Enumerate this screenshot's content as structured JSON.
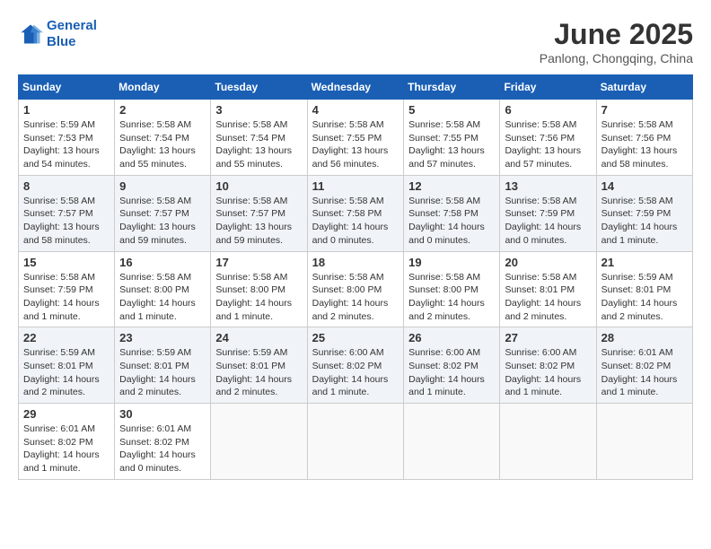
{
  "header": {
    "logo_line1": "General",
    "logo_line2": "Blue",
    "month_year": "June 2025",
    "location": "Panlong, Chongqing, China"
  },
  "weekdays": [
    "Sunday",
    "Monday",
    "Tuesday",
    "Wednesday",
    "Thursday",
    "Friday",
    "Saturday"
  ],
  "weeks": [
    [
      {
        "day": 1,
        "sunrise": "5:59 AM",
        "sunset": "7:53 PM",
        "daylight": "13 hours and 54 minutes."
      },
      {
        "day": 2,
        "sunrise": "5:58 AM",
        "sunset": "7:54 PM",
        "daylight": "13 hours and 55 minutes."
      },
      {
        "day": 3,
        "sunrise": "5:58 AM",
        "sunset": "7:54 PM",
        "daylight": "13 hours and 55 minutes."
      },
      {
        "day": 4,
        "sunrise": "5:58 AM",
        "sunset": "7:55 PM",
        "daylight": "13 hours and 56 minutes."
      },
      {
        "day": 5,
        "sunrise": "5:58 AM",
        "sunset": "7:55 PM",
        "daylight": "13 hours and 57 minutes."
      },
      {
        "day": 6,
        "sunrise": "5:58 AM",
        "sunset": "7:56 PM",
        "daylight": "13 hours and 57 minutes."
      },
      {
        "day": 7,
        "sunrise": "5:58 AM",
        "sunset": "7:56 PM",
        "daylight": "13 hours and 58 minutes."
      }
    ],
    [
      {
        "day": 8,
        "sunrise": "5:58 AM",
        "sunset": "7:57 PM",
        "daylight": "13 hours and 58 minutes."
      },
      {
        "day": 9,
        "sunrise": "5:58 AM",
        "sunset": "7:57 PM",
        "daylight": "13 hours and 59 minutes."
      },
      {
        "day": 10,
        "sunrise": "5:58 AM",
        "sunset": "7:57 PM",
        "daylight": "13 hours and 59 minutes."
      },
      {
        "day": 11,
        "sunrise": "5:58 AM",
        "sunset": "7:58 PM",
        "daylight": "14 hours and 0 minutes."
      },
      {
        "day": 12,
        "sunrise": "5:58 AM",
        "sunset": "7:58 PM",
        "daylight": "14 hours and 0 minutes."
      },
      {
        "day": 13,
        "sunrise": "5:58 AM",
        "sunset": "7:59 PM",
        "daylight": "14 hours and 0 minutes."
      },
      {
        "day": 14,
        "sunrise": "5:58 AM",
        "sunset": "7:59 PM",
        "daylight": "14 hours and 1 minute."
      }
    ],
    [
      {
        "day": 15,
        "sunrise": "5:58 AM",
        "sunset": "7:59 PM",
        "daylight": "14 hours and 1 minute."
      },
      {
        "day": 16,
        "sunrise": "5:58 AM",
        "sunset": "8:00 PM",
        "daylight": "14 hours and 1 minute."
      },
      {
        "day": 17,
        "sunrise": "5:58 AM",
        "sunset": "8:00 PM",
        "daylight": "14 hours and 1 minute."
      },
      {
        "day": 18,
        "sunrise": "5:58 AM",
        "sunset": "8:00 PM",
        "daylight": "14 hours and 2 minutes."
      },
      {
        "day": 19,
        "sunrise": "5:58 AM",
        "sunset": "8:00 PM",
        "daylight": "14 hours and 2 minutes."
      },
      {
        "day": 20,
        "sunrise": "5:58 AM",
        "sunset": "8:01 PM",
        "daylight": "14 hours and 2 minutes."
      },
      {
        "day": 21,
        "sunrise": "5:59 AM",
        "sunset": "8:01 PM",
        "daylight": "14 hours and 2 minutes."
      }
    ],
    [
      {
        "day": 22,
        "sunrise": "5:59 AM",
        "sunset": "8:01 PM",
        "daylight": "14 hours and 2 minutes."
      },
      {
        "day": 23,
        "sunrise": "5:59 AM",
        "sunset": "8:01 PM",
        "daylight": "14 hours and 2 minutes."
      },
      {
        "day": 24,
        "sunrise": "5:59 AM",
        "sunset": "8:01 PM",
        "daylight": "14 hours and 2 minutes."
      },
      {
        "day": 25,
        "sunrise": "6:00 AM",
        "sunset": "8:02 PM",
        "daylight": "14 hours and 1 minute."
      },
      {
        "day": 26,
        "sunrise": "6:00 AM",
        "sunset": "8:02 PM",
        "daylight": "14 hours and 1 minute."
      },
      {
        "day": 27,
        "sunrise": "6:00 AM",
        "sunset": "8:02 PM",
        "daylight": "14 hours and 1 minute."
      },
      {
        "day": 28,
        "sunrise": "6:01 AM",
        "sunset": "8:02 PM",
        "daylight": "14 hours and 1 minute."
      }
    ],
    [
      {
        "day": 29,
        "sunrise": "6:01 AM",
        "sunset": "8:02 PM",
        "daylight": "14 hours and 1 minute."
      },
      {
        "day": 30,
        "sunrise": "6:01 AM",
        "sunset": "8:02 PM",
        "daylight": "14 hours and 0 minutes."
      },
      null,
      null,
      null,
      null,
      null
    ]
  ]
}
